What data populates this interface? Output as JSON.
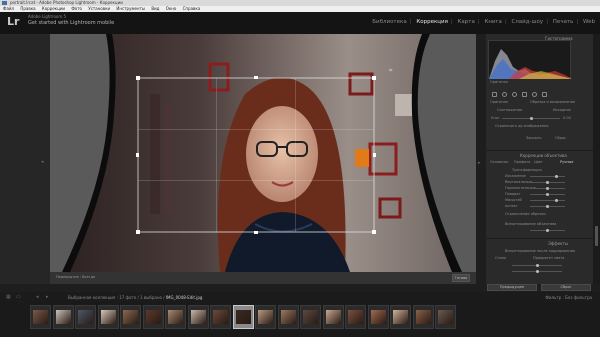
{
  "window": {
    "title": "portrait.lrcat - Adobe Photoshop Lightroom - Коррекции"
  },
  "menu": [
    "Файл",
    "Правка",
    "Коррекции",
    "Фото",
    "Установки",
    "Инструменты",
    "Вид",
    "Окно",
    "Справка"
  ],
  "identity_plate": {
    "small_text": "Adobe Lightroom 5",
    "main_text": "Get started with Lightroom mobile",
    "logo": "Lr"
  },
  "modules": [
    {
      "label": "Библиотека",
      "active": false
    },
    {
      "label": "Коррекция",
      "active": true
    },
    {
      "label": "Карта",
      "active": false
    },
    {
      "label": "Книга",
      "active": false
    },
    {
      "label": "Слайд-шоу",
      "active": false
    },
    {
      "label": "Печать",
      "active": false
    },
    {
      "label": "Web",
      "active": false
    }
  ],
  "right_panel": {
    "histogram_label": "Гистограмма",
    "original_label": "Оригинал",
    "crop_label": "Обрезка и выпрямление",
    "aspect_label": "Соотношение",
    "aspect_value": "Исходное",
    "angle_label": "Угол",
    "angle_value": "0.00",
    "constrain_label": "Ограничить до изображения",
    "close_label": "Закрыть",
    "reset_label": "Сброс",
    "lens_label": "Коррекции объектива",
    "lens_tabs": [
      "Основные",
      "Профиль",
      "Цвет",
      "Ручные"
    ],
    "transform_label": "Трансформация",
    "sliders": [
      "Искажение",
      "Вертикальные",
      "Горизонтальные",
      "Поворот",
      "Масштаб",
      "Аспект"
    ],
    "constrain_crop_label": "Ограничение обрезки",
    "vignette_label": "Виньетирование объектива",
    "effects_label": "Эффекты",
    "postcrop_label": "Виньетирование после кадрирования",
    "style_label": "Стиль",
    "style_value": "Приоритет света",
    "prev_button": "Предыдущее",
    "reset_button": "Сброс"
  },
  "toolbar": {
    "overlay_label": "Перекрытие :",
    "overlay_value": "Всегда",
    "done_button": "Готово"
  },
  "filmstrip": {
    "info_prefix": "Выбранная коллекция : 17 фото / 1 выбрано /",
    "filename": "IMG_0048-Edit.jpg",
    "filter_label": "Фильтр :",
    "filter_value": "Без фильтра",
    "thumbnails": 19,
    "selected_index": 9
  },
  "colors": {
    "accent_active": "#e6e6e6",
    "background": "#1e1e1e",
    "panel": "#2a2a2a",
    "stage": "#595959"
  }
}
